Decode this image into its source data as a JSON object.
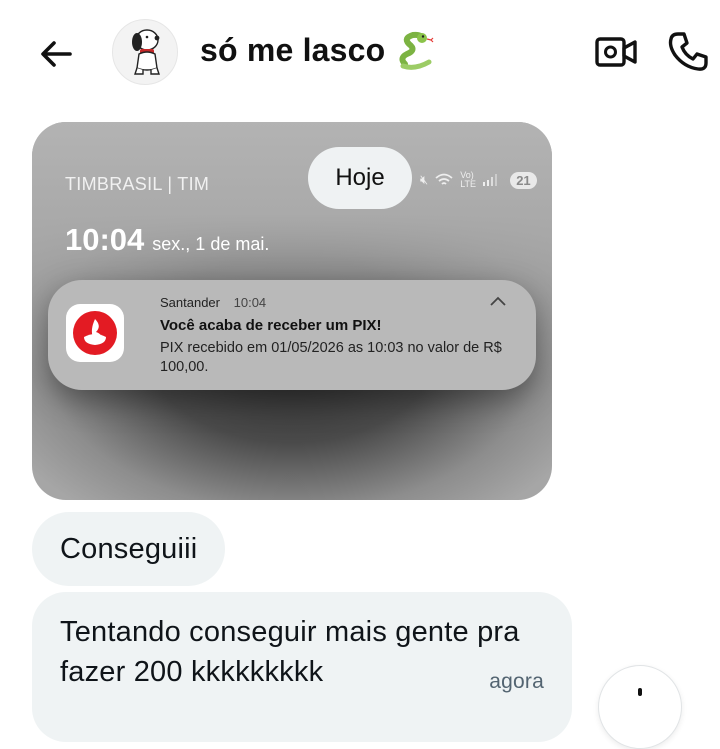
{
  "header": {
    "chat_name": "só me lasco",
    "back_icon": "arrow-left-icon",
    "avatar_icon": "snoopy-avatar",
    "name_emoji": "snake-emoji-icon",
    "video_icon": "video-call-icon",
    "call_icon": "phone-icon"
  },
  "attachment": {
    "carrier": "TIMBRASIL | TIM",
    "battery": "21",
    "network_label": "Vo) LTE",
    "time": "10:04",
    "date": "sex., 1 de mai.",
    "notification": {
      "app": "Santander",
      "time": "10:04",
      "title": "Você acaba de receber um PIX!",
      "body": "PIX recebido em 01/05/2026 as 10:03 no valor de R$ 100,00."
    }
  },
  "day_separator": "Hoje",
  "messages": [
    {
      "text": "Conseguiii"
    },
    {
      "text": "Tentando conseguir mais gente pra fazer 200 kkkkkkkkk",
      "time": "agora"
    }
  ],
  "colors": {
    "bubble": "#eff3f4",
    "santander_red": "#e31b23",
    "timestamp": "#536471"
  }
}
